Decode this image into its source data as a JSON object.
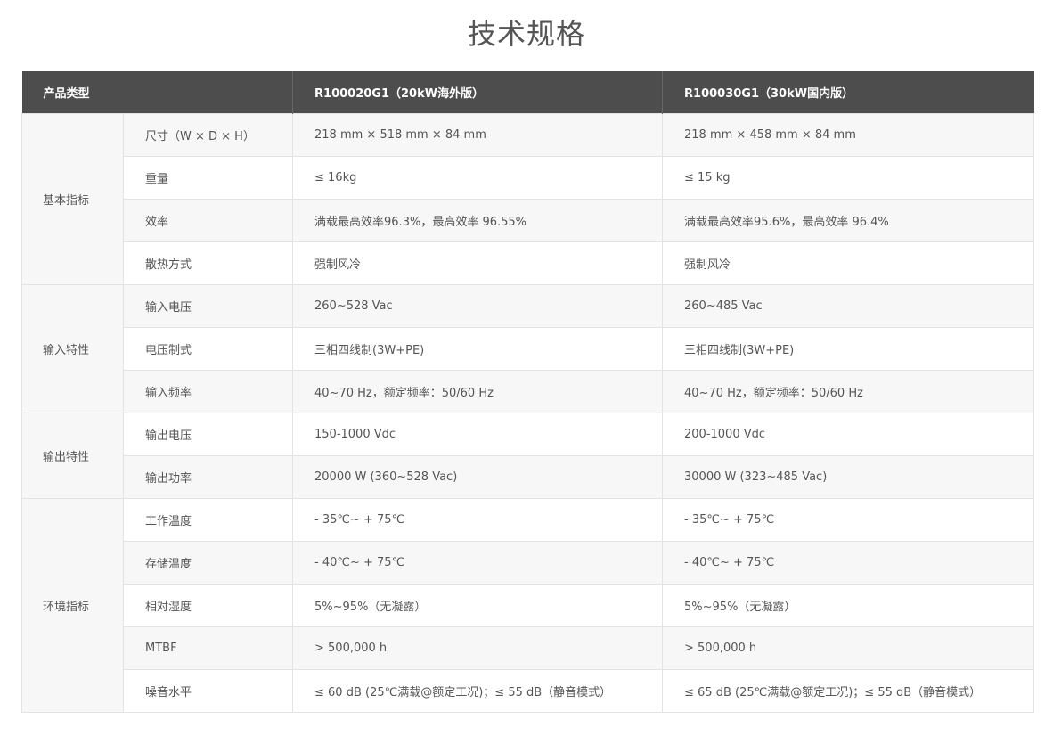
{
  "page_title": "技术规格",
  "header": {
    "col1": "产品类型",
    "col3": "R100020G1（20kW海外版）",
    "col4": "R100030G1（30kW国内版）"
  },
  "groups": [
    {
      "label": "基本指标",
      "rows": [
        {
          "param": "尺寸（W × D × H）",
          "v1": "218 mm × 518 mm × 84 mm",
          "v2": "218 mm × 458 mm × 84 mm"
        },
        {
          "param": "重量",
          "v1": "≤ 16kg",
          "v2": "≤ 15 kg"
        },
        {
          "param": "效率",
          "v1": "满载最高效率96.3%，最高效率 96.55%",
          "v2": "满载最高效率95.6%，最高效率 96.4%"
        },
        {
          "param": "散热方式",
          "v1": "强制风冷",
          "v2": "强制风冷"
        }
      ]
    },
    {
      "label": "输入特性",
      "rows": [
        {
          "param": "输入电压",
          "v1": "260~528 Vac",
          "v2": "260~485 Vac"
        },
        {
          "param": "电压制式",
          "v1": "三相四线制(3W+PE)",
          "v2": "三相四线制(3W+PE)"
        },
        {
          "param": "输入频率",
          "v1": "40~70 Hz，额定频率：50/60 Hz",
          "v2": "40~70 Hz，额定频率：50/60 Hz"
        }
      ]
    },
    {
      "label": "输出特性",
      "rows": [
        {
          "param": "输出电压",
          "v1": "150-1000 Vdc",
          "v2": "200-1000 Vdc"
        },
        {
          "param": "输出功率",
          "v1": "20000 W (360~528 Vac)",
          "v2": "30000 W (323~485 Vac)"
        }
      ]
    },
    {
      "label": "环境指标",
      "rows": [
        {
          "param": "工作温度",
          "v1": " - 35℃~ + 75℃",
          "v2": " - 35℃~ + 75℃"
        },
        {
          "param": "存储温度",
          "v1": " - 40℃~ + 75℃",
          "v2": " - 40℃~ + 75℃"
        },
        {
          "param": "相对湿度",
          "v1": "5%~95%（无凝露）",
          "v2": "5%~95%（无凝露）"
        },
        {
          "param": "MTBF",
          "v1": "> 500,000 h",
          "v2": "> 500,000 h"
        },
        {
          "param": "噪音水平",
          "v1": "≤ 60 dB (25℃满载@额定工况)；≤ 55 dB（静音模式）",
          "v2": "≤ 65 dB (25℃满载@额定工况)；≤ 55 dB（静音模式）"
        }
      ]
    }
  ]
}
